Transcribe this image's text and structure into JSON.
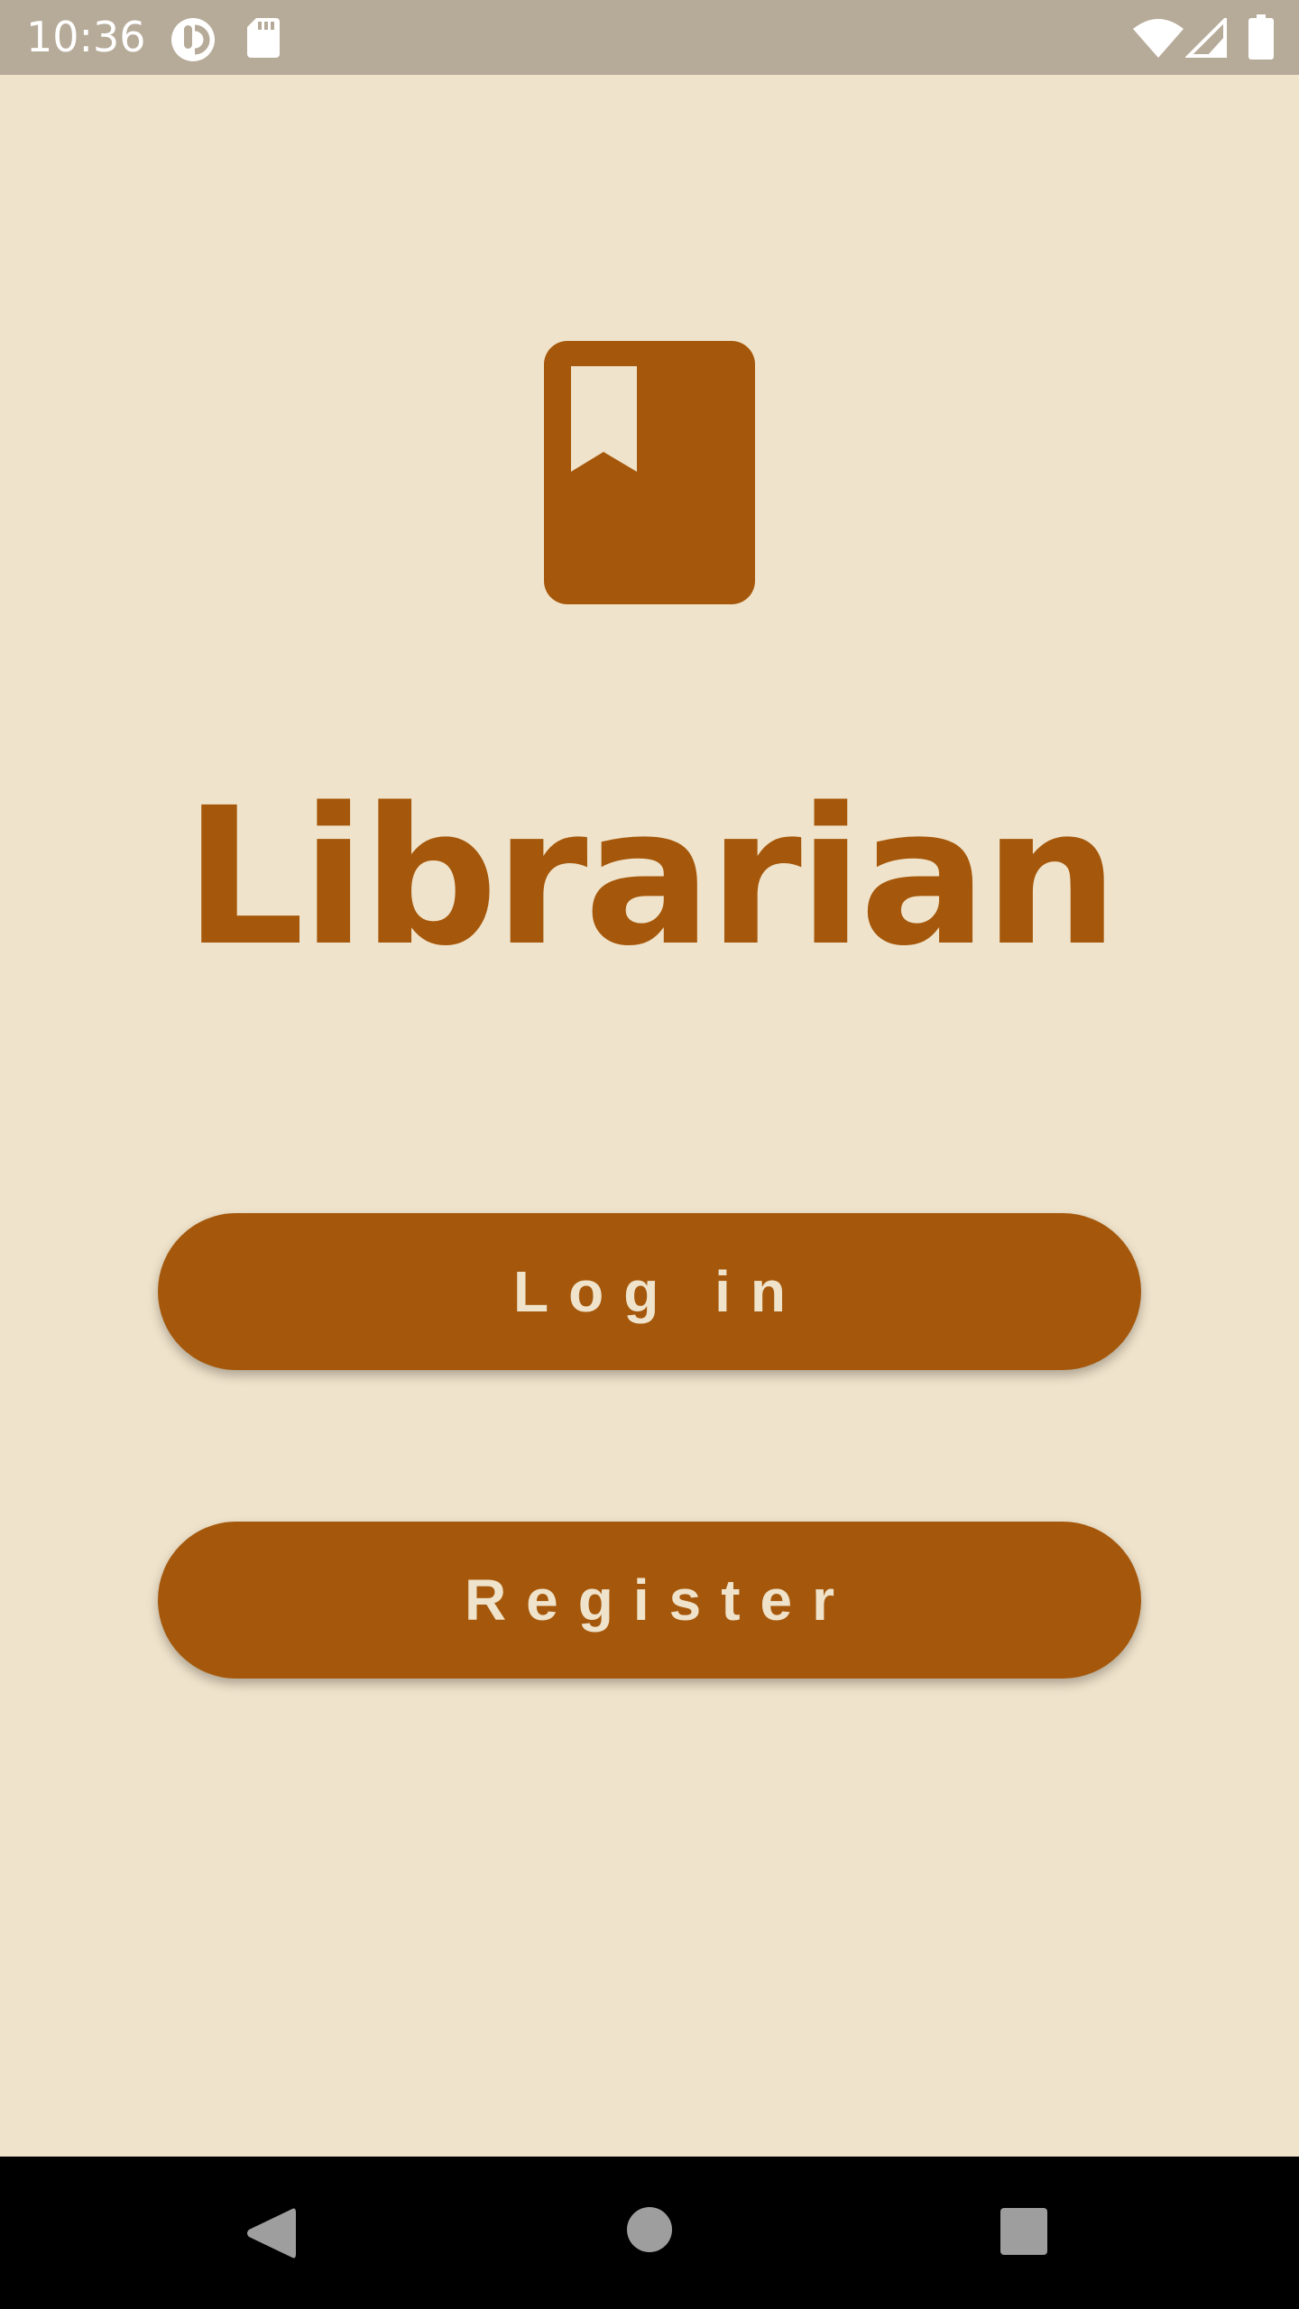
{
  "status_bar": {
    "time": "10:36",
    "left_icons": [
      "data-saver-icon",
      "sd-card-icon"
    ],
    "right_icons": [
      "wifi-icon",
      "cellular-signal-icon",
      "battery-icon"
    ]
  },
  "app": {
    "logo_icon": "book-bookmark-icon",
    "title": "Librarian"
  },
  "buttons": {
    "login_label": "Log in",
    "register_label": "Register"
  },
  "nav_bar": {
    "icons": [
      "back-icon",
      "home-icon",
      "recents-icon"
    ]
  },
  "colors": {
    "background": "#F0E3CB",
    "accent": "#A5580B",
    "button_text": "#F0E3CB",
    "status_bar": "#B6AA98",
    "nav_bar": "#000000"
  }
}
